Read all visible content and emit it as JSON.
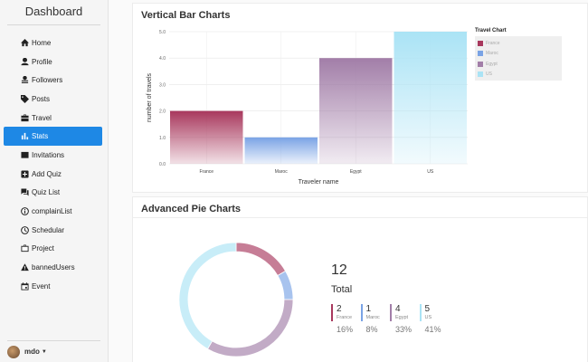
{
  "sidebar": {
    "title": "Dashboard",
    "items": [
      {
        "label": "Home",
        "icon": "home-icon",
        "active": false
      },
      {
        "label": "Profile",
        "icon": "person-icon",
        "active": false
      },
      {
        "label": "Followers",
        "icon": "followers-icon",
        "active": false
      },
      {
        "label": "Posts",
        "icon": "tag-icon",
        "active": false
      },
      {
        "label": "Travel",
        "icon": "suitcase-icon",
        "active": false
      },
      {
        "label": "Stats",
        "icon": "bar-chart-icon",
        "active": true
      },
      {
        "label": "Invitations",
        "icon": "mail-icon",
        "active": false
      },
      {
        "label": "Add Quiz",
        "icon": "add-box-icon",
        "active": false
      },
      {
        "label": "Quiz List",
        "icon": "forum-icon",
        "active": false
      },
      {
        "label": "complainList",
        "icon": "info-circle-icon",
        "active": false
      },
      {
        "label": "Schedular",
        "icon": "clock-icon",
        "active": false
      },
      {
        "label": "Project",
        "icon": "briefcase-icon",
        "active": false
      },
      {
        "label": "bannedUsers",
        "icon": "warning-icon",
        "active": false
      },
      {
        "label": "Event",
        "icon": "calendar-icon",
        "active": false
      }
    ],
    "user": {
      "name": "mdo"
    }
  },
  "bar_card": {
    "title": "Vertical Bar Charts"
  },
  "pie_card": {
    "title": "Advanced Pie Charts"
  },
  "chart_data": [
    {
      "type": "bar",
      "title": "Vertical Bar Charts",
      "categories": [
        "France",
        "Maroc",
        "Egypt",
        "US"
      ],
      "values": [
        2,
        1,
        4,
        5
      ],
      "colors": [
        "#a8385d",
        "#7aa3e5",
        "#a27ea8",
        "#aae3f5"
      ],
      "xlabel": "Traveler name",
      "ylabel": "number of travels",
      "ylim": [
        0,
        5
      ],
      "yticks": [
        "0.0",
        "1.0",
        "2.0",
        "3.0",
        "4.0",
        "5.0"
      ],
      "grid": true,
      "legend": {
        "title": "Travel Chart",
        "position": "right",
        "entries": [
          "France",
          "Maroc",
          "Egypt",
          "US"
        ]
      }
    },
    {
      "type": "pie",
      "title": "Advanced Pie Charts",
      "categories": [
        "France",
        "Maroc",
        "Egypt",
        "US"
      ],
      "values": [
        2,
        1,
        4,
        5
      ],
      "percent_labels": [
        "16%",
        "8%",
        "33%",
        "41%"
      ],
      "colors": [
        "#a8385d",
        "#7aa3e5",
        "#a27ea8",
        "#aae3f5"
      ],
      "total": 12,
      "total_label": "Total"
    }
  ]
}
